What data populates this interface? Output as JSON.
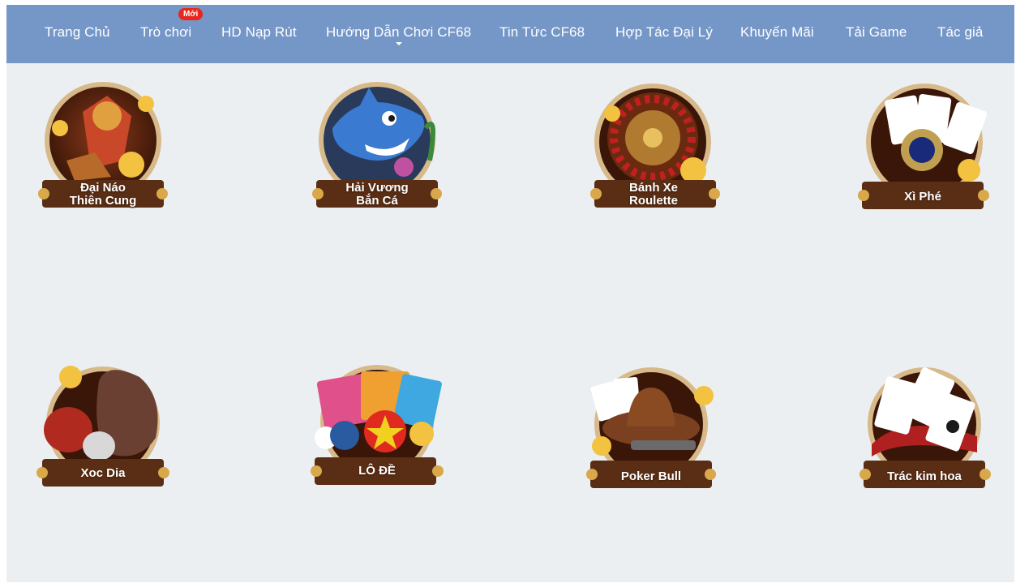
{
  "nav": {
    "items": [
      {
        "label": "Trang Chủ"
      },
      {
        "label": "Trò chơi"
      },
      {
        "label": "HD Nạp Rút"
      },
      {
        "label": "Hướng Dẫn Chơi CF68"
      },
      {
        "label": "Tin Tức CF68"
      },
      {
        "label": "Hợp Tác Đại Lý"
      },
      {
        "label": "Khuyến Mãi"
      },
      {
        "label": "Tải Game"
      },
      {
        "label": "Tác giả"
      }
    ],
    "badge": "Mới"
  },
  "games": [
    {
      "label": "Đại Náo\nThiên Cung",
      "icon": "monkey-king-icon"
    },
    {
      "label": "Hải Vương\nBắn Cá",
      "icon": "shark-icon"
    },
    {
      "label": "Bánh Xe\nRoulette",
      "icon": "roulette-wheel-icon"
    },
    {
      "label": "Xì Phé",
      "icon": "playing-cards-icon"
    },
    {
      "label": "Xoc Dia",
      "icon": "bowl-and-coins-icon"
    },
    {
      "label": "LÔ ĐỀ",
      "icon": "bingo-balls-icon"
    },
    {
      "label": "Poker Bull",
      "icon": "cowboy-hat-revolver-icon"
    },
    {
      "label": "Trác kim hoa",
      "icon": "cards-fan-icon"
    }
  ],
  "colors": {
    "navbar": "#7597c8",
    "background": "#eceff2",
    "badge": "#e8261c",
    "frame_gold": "#c89a5a",
    "frame_dark": "#4a2412"
  }
}
